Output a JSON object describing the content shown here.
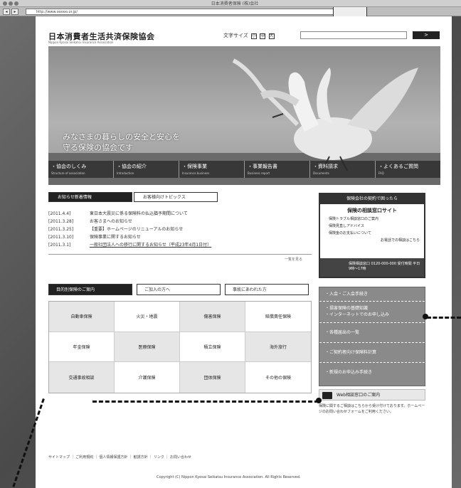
{
  "window": {
    "title": "日本消費者保険 (株)会社"
  },
  "browser": {
    "url": "http://www.ooooo.or.jp/"
  },
  "header": {
    "logo": "日本消費者生活共済保険協会",
    "logo_en": "Nippon Kyosai Seikatsu Insurance Association",
    "text_size_label": "文字サイズ",
    "text_size_options": [
      "小",
      "中",
      "大"
    ],
    "search_button": ">"
  },
  "hero": {
    "caption_line1": "みなさまの暮らしの安全と安心を",
    "caption_line2": "守る保険の協会です"
  },
  "global_nav": [
    {
      "jp": "・協会のしくみ",
      "en": "Structure of association"
    },
    {
      "jp": "・協会の紹介",
      "en": "Introduction"
    },
    {
      "jp": "・保険事業",
      "en": "Insurance business"
    },
    {
      "jp": "・事業報告書",
      "en": "Business report"
    },
    {
      "jp": "・資料請求",
      "en": "Documents"
    },
    {
      "jp": "・よくあるご質問",
      "en": "FAQ"
    }
  ],
  "news": {
    "tabs": [
      "お知らせ新着情報",
      "お客様向けトピックス"
    ],
    "items": [
      {
        "date": "[2011.4.4]",
        "text": "東日本大震災に係る保険料の払込猶予期間について"
      },
      {
        "date": "[2011.3.28]",
        "text": "お客さまへのお知らせ"
      },
      {
        "date": "[2011.3.25]",
        "text": "【重要】ホームページのリニューアルのお知らせ"
      },
      {
        "date": "[2011.3.10]",
        "text": "保険事業に関するお知らせ"
      },
      {
        "date": "[2011.3.1]",
        "text": "一般社団法人への移行に関するお知らせ（平成23年4月1日付）"
      }
    ],
    "more": "一覧を見る"
  },
  "banner": {
    "head": "保険会社の契約で困ったら",
    "title": "保険の相談窓口サイト",
    "lines": [
      "保険トラブル相談窓口のご案内",
      "保険見直しアドバイス",
      "保険金のお支払いについて"
    ],
    "phone_note": "お電話での相談はこちら",
    "foot": "保険相談窓口 0120-000-000 受付時間 平日9時～17時"
  },
  "category": {
    "tabs": [
      "目的別保険のご案内",
      "ご加入の方へ",
      "事故にあわれた方"
    ],
    "cells": [
      "自動車保険",
      "火災・地震",
      "傷害保険",
      "賠償責任保険",
      "年金保険",
      "医療保険",
      "積立保険",
      "海外旅行",
      "交通事故相談",
      "介護保険",
      "団体保険",
      "その他の保険"
    ]
  },
  "side_menu": [
    "・入会・ご入会手続き",
    "・損害保険の基礎知識",
    "・インターネットでのお申し込み",
    "・各種届出の一覧",
    "・ご契約者向け保険料計算",
    "・新規のお申込み手続き"
  ],
  "web_box": {
    "title": "Web相談窓口のご案内",
    "text": "保険に関するご相談はこちらから受け付けております。ホームページのお問い合わせフォームをご利用ください。"
  },
  "footer": {
    "links": [
      "サイトマップ",
      "ご利用規約",
      "個人情報保護方針",
      "勧誘方針",
      "リンク",
      "お問い合わせ"
    ],
    "copyright": "Copyright (C) Nippon Kyosai Seikatsu Insurance Association. All Rights Reserved."
  }
}
